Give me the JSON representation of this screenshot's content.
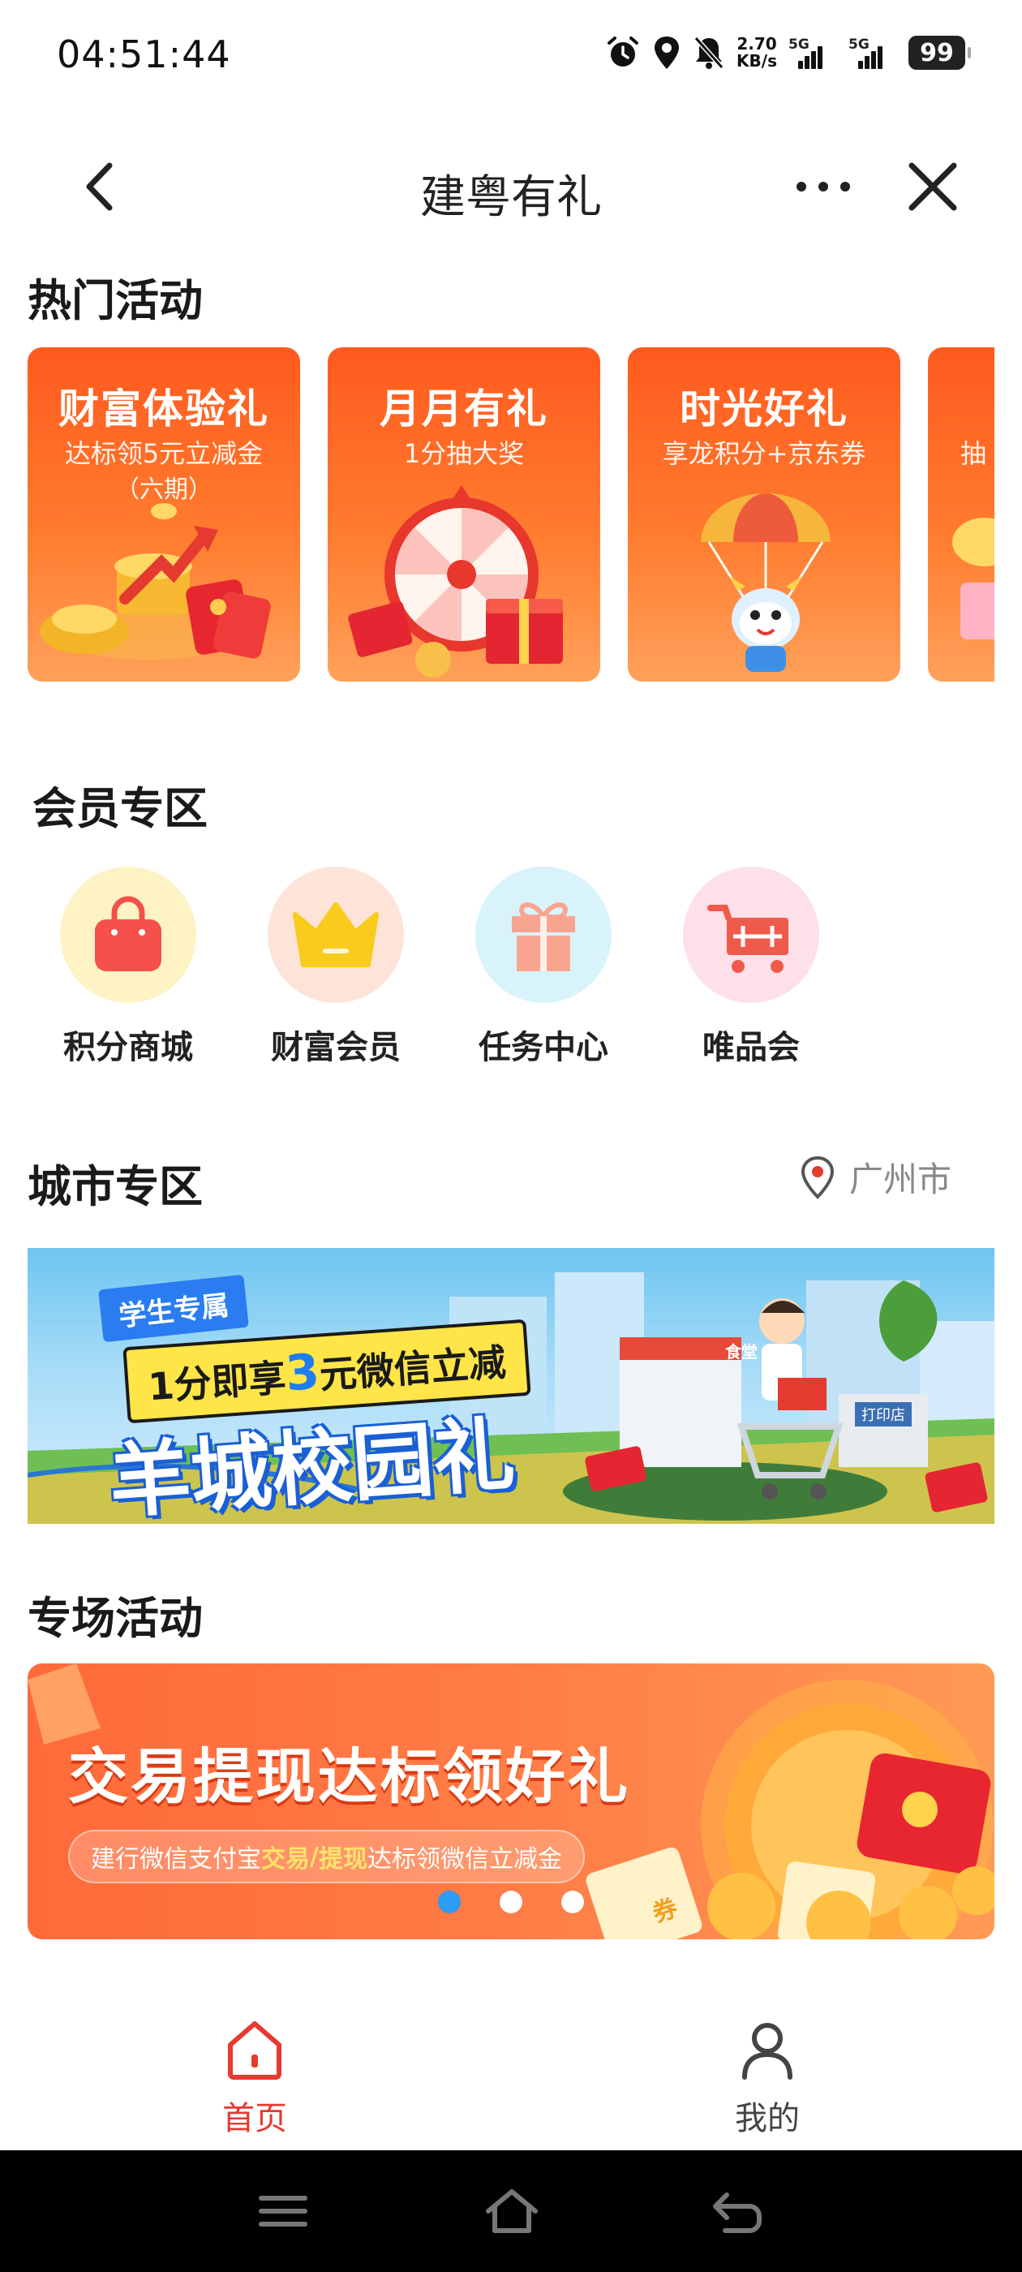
{
  "status": {
    "time": "04:51:44",
    "net_speed_value": "2.70",
    "net_speed_unit": "KB/s",
    "signal1_label": "5G",
    "signal2_label": "5G",
    "battery": "99"
  },
  "nav": {
    "title": "建粤有礼"
  },
  "hot": {
    "title": "热门活动",
    "cards": [
      {
        "title": "财富体验礼",
        "subtitle": "达标领5元立减金",
        "subtitle2": "（六期）"
      },
      {
        "title": "月月有礼",
        "subtitle": "1分抽大奖",
        "subtitle2": ""
      },
      {
        "title": "时光好礼",
        "subtitle": "享龙积分+京东券",
        "subtitle2": ""
      },
      {
        "title": "",
        "subtitle": "抽",
        "subtitle2": ""
      }
    ]
  },
  "member": {
    "title": "会员专区",
    "items": [
      {
        "label": "积分商城",
        "icon": "shopping-bag-icon",
        "bg": "#fdf3c4",
        "color": "#f5504a"
      },
      {
        "label": "财富会员",
        "icon": "crown-icon",
        "bg": "#fde3d8",
        "color": "#f8cb1c"
      },
      {
        "label": "任务中心",
        "icon": "gift-icon",
        "bg": "#d9f3fb",
        "color": "#f8a58f"
      },
      {
        "label": "唯品会",
        "icon": "shopping-cart-icon",
        "bg": "#fde0ea",
        "color": "#f05a4a"
      }
    ]
  },
  "city": {
    "title": "城市专区",
    "location": "广州市",
    "banner": {
      "tag": "学生专属",
      "line1_pre": "1分即享",
      "line1_num": "3",
      "line1_post": "元微信立减",
      "line2": "羊城校园礼",
      "shop_sign1": "食堂",
      "shop_sign2": "打印店"
    }
  },
  "special": {
    "title": "专场活动",
    "banner_title": "交易提现达标领好礼",
    "pill_pre": "建行微信支付宝",
    "pill_hl1": "交易",
    "pill_sep": "/",
    "pill_hl2": "提现",
    "pill_post": "达标领微信立减金",
    "coin_text": "券",
    "carousel_active": 1,
    "carousel_count": 3
  },
  "tabs": [
    {
      "label": "首页",
      "icon": "home-icon",
      "active": true
    },
    {
      "label": "我的",
      "icon": "user-icon",
      "active": false
    }
  ],
  "colors": {
    "accent_red": "#e53a2f",
    "card_orange": "#ff5a1f",
    "dot_active": "#2a9df4"
  }
}
